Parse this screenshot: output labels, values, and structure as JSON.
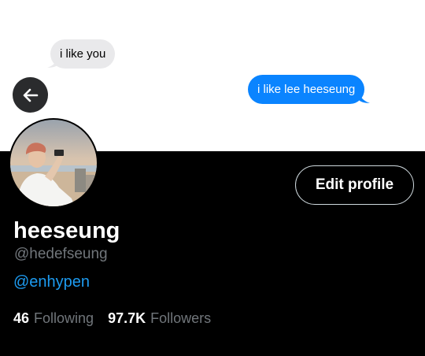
{
  "banner": {
    "messages": [
      {
        "text": "i like you",
        "side": "received",
        "color": "#e9e9eb"
      },
      {
        "text": "i like lee heeseung",
        "side": "sent",
        "color": "#0a84ff"
      }
    ]
  },
  "header": {
    "back_icon": "arrow-left-icon"
  },
  "profile": {
    "avatar_alt": "avatar",
    "edit_button_label": "Edit profile",
    "display_name": "heeseung",
    "handle": "@hedefseung",
    "bio_link": "@enhypen",
    "following_count": "46",
    "following_label": "Following",
    "followers_count": "97.7K",
    "followers_label": "Followers"
  },
  "colors": {
    "background": "#000000",
    "link": "#1d9bf0",
    "muted_text": "#71767b",
    "sent_bubble": "#0a84ff",
    "received_bubble": "#e9e9eb"
  }
}
